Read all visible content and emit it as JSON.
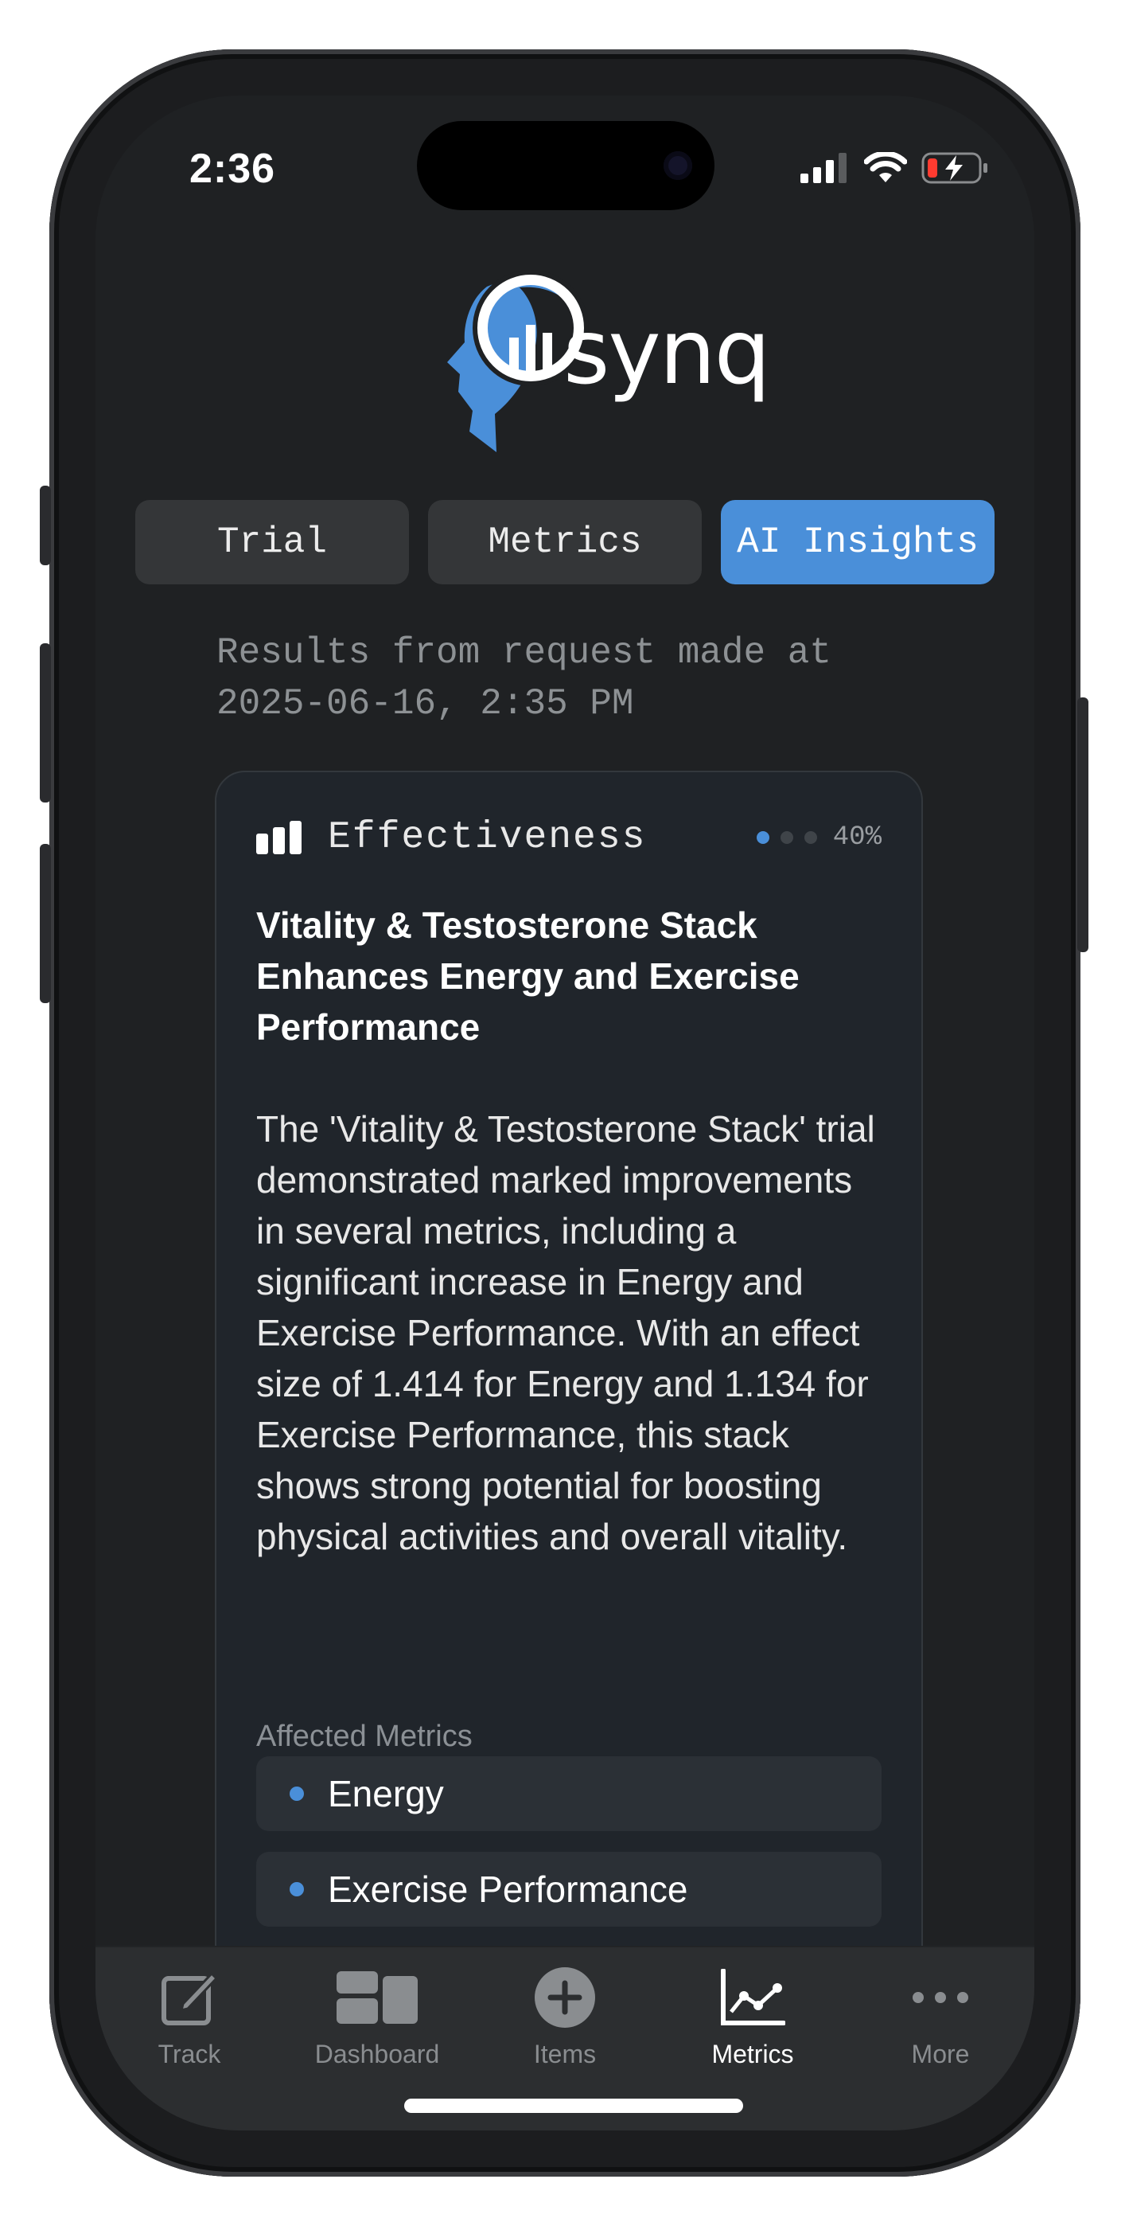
{
  "status_bar": {
    "time": "2:36"
  },
  "brand": {
    "name": "synq"
  },
  "tabs": [
    {
      "label": "Trial",
      "active": false
    },
    {
      "label": "Metrics",
      "active": false
    },
    {
      "label": "AI Insights",
      "active": true
    }
  ],
  "results": {
    "line1": "Results from request made at",
    "line2": "2025-06-16, 2:35 PM"
  },
  "insight": {
    "category": "Effectiveness",
    "confidence": "40%",
    "confidence_level": 1,
    "confidence_max": 3,
    "headline": "Vitality & Testosterone Stack Enhances Energy and Exercise Performance",
    "body": "The 'Vitality & Testosterone Stack' trial demonstrated marked improvements in several metrics, including a significant increase in Energy and Exercise Performance. With an effect size of 1.414 for Energy and 1.134 for Exercise Performance, this stack shows strong potential for boosting physical activities and overall vitality.",
    "affected_label": "Affected Metrics",
    "affected": [
      "Energy",
      "Exercise Performance"
    ]
  },
  "tabbar": [
    {
      "label": "Track",
      "icon": "edit-icon",
      "active": false
    },
    {
      "label": "Dashboard",
      "icon": "dashboard-icon",
      "active": false
    },
    {
      "label": "Items",
      "icon": "plus-circle-icon",
      "active": false
    },
    {
      "label": "Metrics",
      "icon": "line-chart-icon",
      "active": true
    },
    {
      "label": "More",
      "icon": "more-dots-icon",
      "active": false
    }
  ],
  "colors": {
    "accent": "#4a8fd9",
    "background": "#1f2123",
    "card": "#20252b"
  }
}
